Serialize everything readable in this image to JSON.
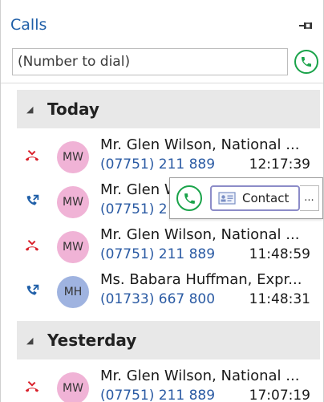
{
  "panel": {
    "title": "Calls",
    "pin_icon": "pin-icon"
  },
  "dial": {
    "placeholder": "(Number to dial)",
    "call_icon": "phone-icon",
    "accent_color": "#1aa34a"
  },
  "groups": {
    "today": {
      "label": "Today",
      "icon": "collapse-triangle-icon"
    },
    "yesterday": {
      "label": "Yesterday",
      "icon": "collapse-triangle-icon"
    }
  },
  "calls": [
    {
      "type": "missed",
      "icon": "missed-call-icon",
      "initials": "MW",
      "avatar_color": "#f0b3d6",
      "name": "Mr. Glen Wilson, National ...",
      "number": "(07751) 211 889",
      "time": "12:17:39"
    },
    {
      "type": "outgoing",
      "icon": "outgoing-call-icon",
      "initials": "MW",
      "avatar_color": "#f0b3d6",
      "name": "Mr. Glen W",
      "number": "(07751) 2",
      "time": ""
    },
    {
      "type": "missed",
      "icon": "missed-call-icon",
      "initials": "MW",
      "avatar_color": "#f0b3d6",
      "name": "Mr. Glen Wilson, National ...",
      "number": "(07751) 211 889",
      "time": "11:48:59"
    },
    {
      "type": "outgoing",
      "icon": "outgoing-call-icon",
      "initials": "MH",
      "avatar_color": "#9fb3e0",
      "name": "Ms. Babara Huffman, Expr...",
      "number": "(01733) 667 800",
      "time": "11:48:31"
    },
    {
      "type": "missed",
      "icon": "missed-call-icon",
      "initials": "MW",
      "avatar_color": "#f0b3d6",
      "name": "Mr. Glen Wilson, National ...",
      "number": "(07751) 211 889",
      "time": "17:07:19"
    }
  ],
  "hover_toolbar": {
    "call_icon": "phone-icon",
    "contact_label": "Contact",
    "contact_icon": "contact-card-icon",
    "more_label": "..."
  },
  "colors": {
    "missed": "#d9202a",
    "outgoing": "#1f5fa8",
    "number": "#2a5aa3",
    "title": "#1f5fa8"
  }
}
